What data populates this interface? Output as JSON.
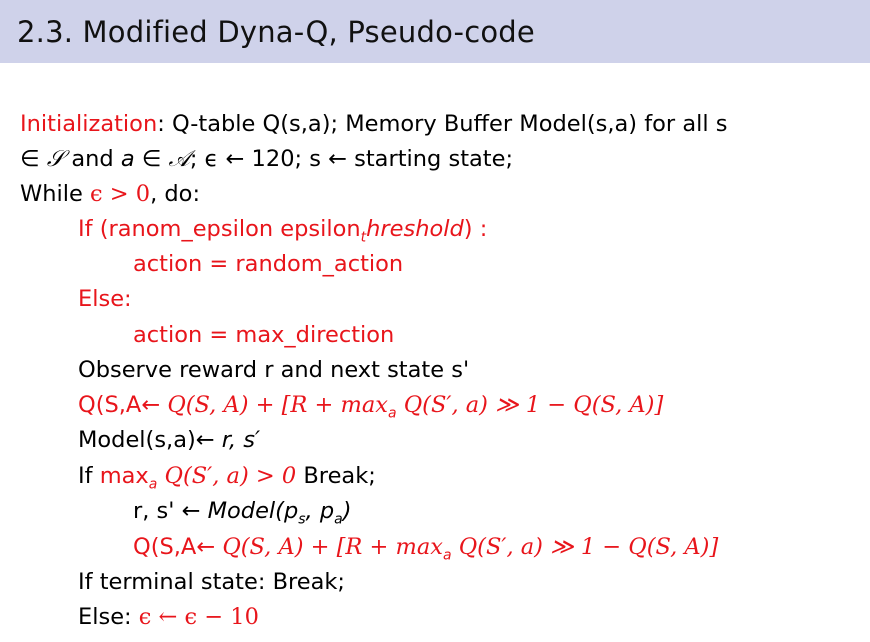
{
  "slide": {
    "title": "2.3. Modified Dyna-Q, Pseudo-code"
  },
  "lines": [
    {
      "parts": [
        "Initialization",
        ": Q-table  Q(s,a);  Memory Buffer Model(s,a) for all s"
      ]
    },
    {
      "parts": [
        "∈ ",
        "𝒮",
        " and ",
        "a",
        " ∈ ",
        "𝒜",
        "; ϵ ← 120;  s ← starting state;"
      ]
    },
    {
      "parts": [
        "While ",
        "ϵ > 0",
        ", do:"
      ]
    },
    {
      "parts": [
        "If (ranom_epsilon  epsilon",
        "t",
        "hreshold",
        ") :"
      ]
    },
    {
      "parts": [
        "action = random_action"
      ]
    },
    {
      "parts": [
        "Else:"
      ]
    },
    {
      "parts": [
        "action = max_direction"
      ]
    },
    {
      "parts": [
        "Observe reward r and next state s'"
      ]
    },
    {
      "parts": [
        "Q(S,A← ",
        "Q(S, A) + [R + max",
        "a",
        " Q(S′, a) ≫ 1 − Q(S, A)]"
      ]
    },
    {
      "parts": [
        "Model(s,a)← ",
        "r, s′"
      ]
    },
    {
      "parts": [
        "If ",
        "max",
        "a",
        " Q(S′, a) > 0",
        " Break;"
      ]
    },
    {
      "parts": [
        "r, s' ← ",
        "Model(p",
        "s",
        ", p",
        "a",
        ")"
      ]
    },
    {
      "parts": [
        "Q(S,A← ",
        "Q(S, A) + [R + max",
        "a",
        " Q(S′, a) ≫ 1 − Q(S, A)]"
      ]
    },
    {
      "parts": [
        "If terminal state: Break;"
      ]
    },
    {
      "parts": [
        "Else: ",
        "ϵ ← ϵ − 10"
      ]
    }
  ],
  "colors": {
    "header_bg": "#cfd2ea",
    "accent_red": "#e8151b",
    "text": "#000000"
  }
}
